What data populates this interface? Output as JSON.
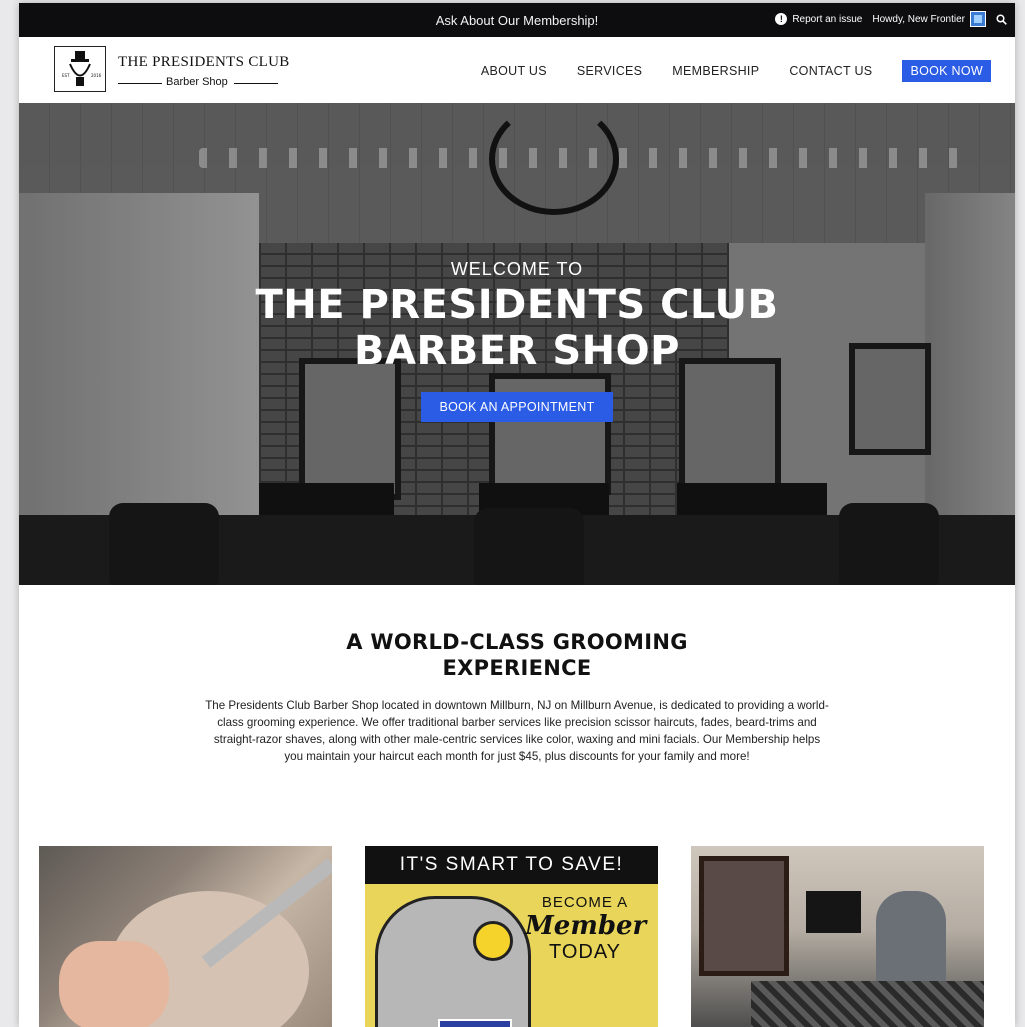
{
  "topbar": {
    "announcement": "Ask About Our Membership!",
    "report_issue": "Report an issue",
    "greeting": "Howdy, New Frontier"
  },
  "header": {
    "logo_title": "THE PRESIDENTS CLUB",
    "logo_sub": "Barber Shop",
    "nav": {
      "about": "ABOUT US",
      "services": "SERVICES",
      "membership": "MEMBERSHIP",
      "contact": "CONTACT US",
      "book": "BOOK NOW"
    }
  },
  "hero": {
    "kicker": "WELCOME TO",
    "title": "THE PRESIDENTS CLUB BARBER SHOP",
    "cta": "BOOK AN APPOINTMENT"
  },
  "intro": {
    "title_line1": "A WORLD-CLASS GROOMING",
    "title_line2": "EXPERIENCE",
    "body": "The Presidents Club Barber Shop located in downtown Millburn, NJ on Millburn Avenue, is dedicated to providing a world-class grooming experience. We offer traditional barber services like precision scissor haircuts, fades, beard-trims and straight-razor shaves, along with other male-centric services like color, waxing and mini facials. Our Membership helps you maintain your haircut each month for just $45, plus discounts for your family and more!"
  },
  "cards": {
    "promo_header": "IT'S SMART TO SAVE!",
    "promo_line1": "BECOME A",
    "promo_line2": "Member",
    "promo_line3": "TODAY"
  },
  "colors": {
    "accent": "#2b5ce6",
    "topbar_bg": "#0d0d0f"
  }
}
